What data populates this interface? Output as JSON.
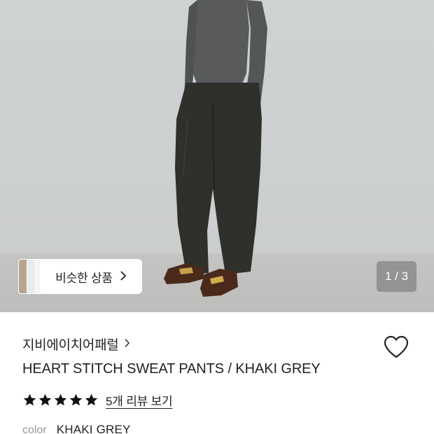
{
  "similar": {
    "label": "비슷한 상품"
  },
  "pager": {
    "text": "1 / 3",
    "current": 1,
    "total": 3
  },
  "product": {
    "brand": "지비에이치어패럴",
    "title": "HEART STITCH SWEAT PANTS / KHAKI GREY",
    "rating_stars": 5,
    "review_link": "5개 리뷰 보기",
    "color_label": "color",
    "color_value": "KHAKI GREY"
  },
  "icons": {
    "chevron": "chevron-right-icon",
    "wishlist": "heart-outline-icon",
    "star": "star-filled-icon"
  },
  "colors": {
    "background": "#ffffff",
    "text": "#222222",
    "muted": "#999999",
    "pager_bg": "#6e6e6e",
    "star": "#111111"
  }
}
